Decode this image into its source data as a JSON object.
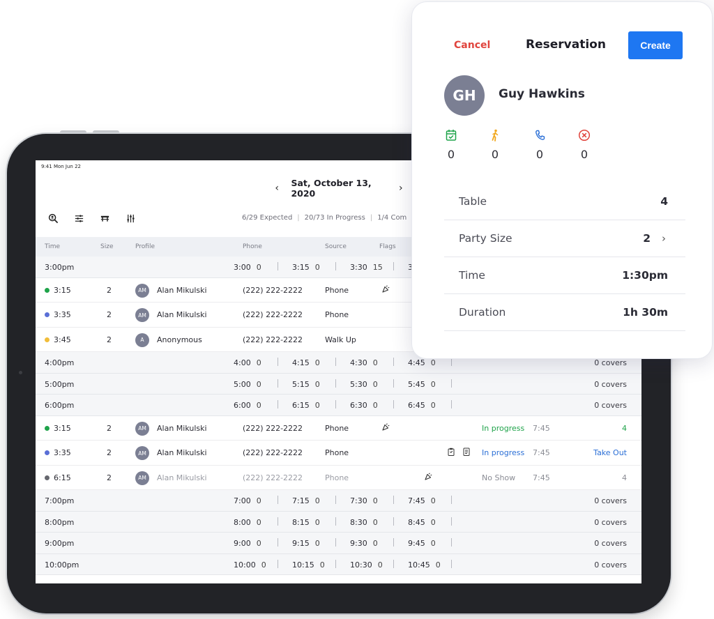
{
  "status_bar": {
    "clock": "9:41 Mon Jun 22"
  },
  "date_nav": {
    "label": "Sat, October 13, 2020",
    "prev_icon": "chevron-left-icon",
    "next_icon": "chevron-right-icon"
  },
  "toolbar": {
    "icons": [
      "search-person-icon",
      "filter-icon",
      "table-icon",
      "sliders-icon"
    ]
  },
  "summary": {
    "expected": "6/29 Expected",
    "in_progress": "20/73 In Progress",
    "completed": "1/4 Com"
  },
  "columns": {
    "time": "Time",
    "size": "Size",
    "profile": "Profile",
    "phone": "Phone",
    "source": "Source",
    "flags": "Flags"
  },
  "rows": [
    {
      "kind": "slot",
      "time": "3:00pm",
      "slots": [
        {
          "t": "3:00",
          "n": "0"
        },
        {
          "t": "3:15",
          "n": "0"
        },
        {
          "t": "3:30",
          "n": "15"
        },
        {
          "t": "3",
          "n": ""
        }
      ],
      "covers": ""
    },
    {
      "kind": "res",
      "dot": "#1fa34a",
      "time": "3:15",
      "size": "2",
      "initials": "AM",
      "name": "Alan Mikulski",
      "phone": "(222) 222-2222",
      "source": "Phone",
      "flag": "party",
      "status": "",
      "duration": "",
      "tail": ""
    },
    {
      "kind": "res",
      "dot": "#5a6fd6",
      "time": "3:35",
      "size": "2",
      "initials": "AM",
      "name": "Alan Mikulski",
      "phone": "(222) 222-2222",
      "source": "Phone",
      "flag": "",
      "status": "",
      "duration": "",
      "tail": ""
    },
    {
      "kind": "res",
      "dot": "#f1bd3a",
      "time": "3:45",
      "size": "2",
      "initials": "A",
      "name": "Anonymous",
      "phone": "(222) 222-2222",
      "source": "Walk Up",
      "flag": "",
      "status": "",
      "duration": "",
      "tail": ""
    },
    {
      "kind": "slot",
      "time": "4:00pm",
      "slots": [
        {
          "t": "4:00",
          "n": "0"
        },
        {
          "t": "4:15",
          "n": "0"
        },
        {
          "t": "4:30",
          "n": "0"
        },
        {
          "t": "4:45",
          "n": "0"
        }
      ],
      "covers": "0 covers"
    },
    {
      "kind": "slot",
      "time": "5:00pm",
      "slots": [
        {
          "t": "5:00",
          "n": "0"
        },
        {
          "t": "5:15",
          "n": "0"
        },
        {
          "t": "5:30",
          "n": "0"
        },
        {
          "t": "5:45",
          "n": "0"
        }
      ],
      "covers": "0 covers"
    },
    {
      "kind": "slot",
      "time": "6:00pm",
      "slots": [
        {
          "t": "6:00",
          "n": "0"
        },
        {
          "t": "6:15",
          "n": "0"
        },
        {
          "t": "6:30",
          "n": "0"
        },
        {
          "t": "6:45",
          "n": "0"
        }
      ],
      "covers": "0 covers"
    },
    {
      "kind": "res",
      "dot": "#1fa34a",
      "time": "3:15",
      "size": "2",
      "initials": "AM",
      "name": "Alan Mikulski",
      "phone": "(222) 222-2222",
      "source": "Phone",
      "flag": "party",
      "status": "In progress",
      "status_color": "#1fa34a",
      "duration": "7:45",
      "tail": "4",
      "tail_color": "#1fa34a"
    },
    {
      "kind": "res",
      "dot": "#5a6fd6",
      "time": "3:35",
      "size": "2",
      "initials": "AM",
      "name": "Alan Mikulski",
      "phone": "(222) 222-2222",
      "source": "Phone",
      "flag": "notes",
      "status": "In progress",
      "status_color": "#2b6fd6",
      "duration": "7:45",
      "tail": "Take Out",
      "tail_color": "#2b6fd6"
    },
    {
      "kind": "res",
      "dot": "#66676e",
      "time": "6:15",
      "size": "2",
      "initials": "AM",
      "name": "Alan Mikulski",
      "phone": "(222) 222-2222",
      "source": "Phone",
      "flag": "party-right",
      "status": "No Show",
      "status_color": "#8a8c94",
      "duration": "7:45",
      "tail": "4",
      "tail_color": "#8a8c94",
      "dim": true
    },
    {
      "kind": "slot",
      "time": "7:00pm",
      "slots": [
        {
          "t": "7:00",
          "n": "0"
        },
        {
          "t": "7:15",
          "n": "0"
        },
        {
          "t": "7:30",
          "n": "0"
        },
        {
          "t": "7:45",
          "n": "0"
        }
      ],
      "covers": "0 covers"
    },
    {
      "kind": "slot",
      "time": "8:00pm",
      "slots": [
        {
          "t": "8:00",
          "n": "0"
        },
        {
          "t": "8:15",
          "n": "0"
        },
        {
          "t": "8:30",
          "n": "0"
        },
        {
          "t": "8:45",
          "n": "0"
        }
      ],
      "covers": "0 covers"
    },
    {
      "kind": "slot",
      "time": "9:00pm",
      "slots": [
        {
          "t": "9:00",
          "n": "0"
        },
        {
          "t": "9:15",
          "n": "0"
        },
        {
          "t": "9:30",
          "n": "0"
        },
        {
          "t": "9:45",
          "n": "0"
        }
      ],
      "covers": "0 covers"
    },
    {
      "kind": "slot",
      "time": "10:00pm",
      "slots": [
        {
          "t": "10:00",
          "n": "0"
        },
        {
          "t": "10:15",
          "n": "0"
        },
        {
          "t": "10:30",
          "n": "0"
        },
        {
          "t": "10:45",
          "n": "0"
        }
      ],
      "covers": "0 covers"
    }
  ],
  "reservation": {
    "cancel_label": "Cancel",
    "title": "Reservation",
    "create_label": "Create",
    "guest": {
      "initials": "GH",
      "name": "Guy Hawkins"
    },
    "stats": [
      {
        "icon": "calendar-check-icon",
        "color": "#1fa34a",
        "value": "0"
      },
      {
        "icon": "walk-in-icon",
        "color": "#f1a81f",
        "value": "0"
      },
      {
        "icon": "phone-icon",
        "color": "#2b6fd6",
        "value": "0"
      },
      {
        "icon": "no-show-icon",
        "color": "#e0443d",
        "value": "0"
      }
    ],
    "fields": [
      {
        "label": "Table",
        "value": "4",
        "chevron": false
      },
      {
        "label": "Party Size",
        "value": "2",
        "chevron": true
      },
      {
        "label": "Time",
        "value": "1:30pm",
        "chevron": false
      },
      {
        "label": "Duration",
        "value": "1h 30m",
        "chevron": false
      }
    ]
  }
}
